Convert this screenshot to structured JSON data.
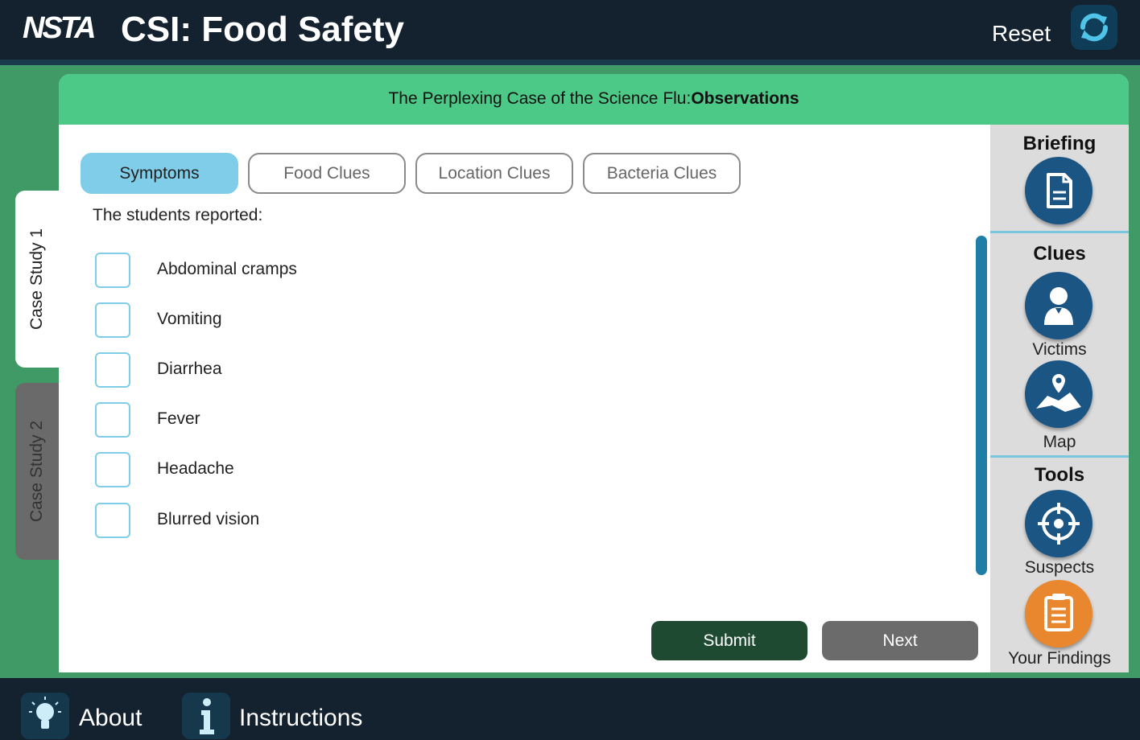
{
  "header": {
    "logo": "NSTA",
    "title": "CSI: Food Safety",
    "reset_label": "Reset"
  },
  "case": {
    "title": "The Perplexing Case of the Science Flu:",
    "section": "Observations"
  },
  "side_tabs": [
    "Case Study 1",
    "Case Study 2"
  ],
  "tabs": [
    "Symptoms",
    "Food Clues",
    "Location Clues",
    "Bacteria Clues"
  ],
  "prompt": "The students reported:",
  "symptoms": [
    "Abdominal cramps",
    "Vomiting",
    "Diarrhea",
    "Fever",
    "Headache",
    "Blurred vision"
  ],
  "buttons": {
    "submit": "Submit",
    "next": "Next"
  },
  "right_panel": {
    "briefing": "Briefing",
    "clues": "Clues",
    "victims": "Victims",
    "map": "Map",
    "tools": "Tools",
    "suspects": "Suspects",
    "findings": "Your Findings"
  },
  "footer": {
    "about": "About",
    "instructions": "Instructions"
  },
  "icons": {
    "reset": "refresh-icon",
    "briefing": "document-icon",
    "victims": "person-icon",
    "map": "map-pin-icon",
    "suspects": "crosshair-icon",
    "findings": "clipboard-icon",
    "about": "lightbulb-icon",
    "instructions": "info-icon"
  },
  "colors": {
    "header_bg": "#14222f",
    "page_bg": "#3f9a66",
    "panel_header": "#4dc987",
    "active_tab": "#7fcde8",
    "submit": "#1d4a31",
    "next": "#6b6b6b",
    "circle_blue": "#1b5584",
    "circle_orange": "#e8872d"
  }
}
